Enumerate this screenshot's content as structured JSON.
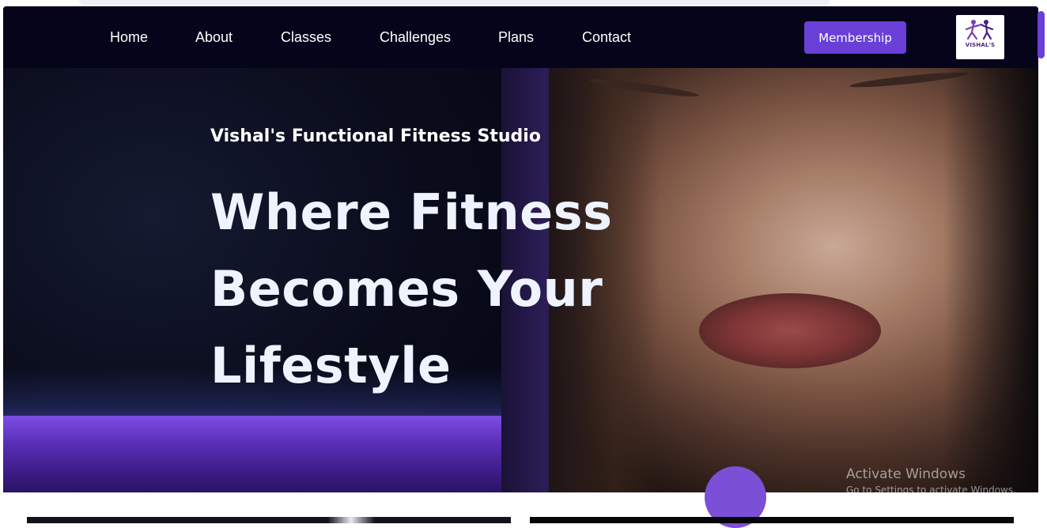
{
  "nav": {
    "items": [
      {
        "label": "Home"
      },
      {
        "label": "About"
      },
      {
        "label": "Classes"
      },
      {
        "label": "Challenges"
      },
      {
        "label": "Plans"
      },
      {
        "label": "Contact"
      }
    ],
    "membership_label": "Membership",
    "logo_text": "VISHAL'S"
  },
  "hero": {
    "subtitle": "Vishal's Functional Fitness Studio",
    "headline_lines": [
      "Where Fitness",
      "Becomes Your",
      "Lifestyle"
    ]
  },
  "watermark": {
    "line1": "Activate Windows",
    "line2": "Go to Settings to activate Windows."
  },
  "colors": {
    "accent": "#6a3fd8",
    "nav_bg": "#05041a",
    "floor": "#7e4de6",
    "headline": "#eef3ff"
  },
  "icons": {
    "logo": "studio-logo-icon"
  }
}
